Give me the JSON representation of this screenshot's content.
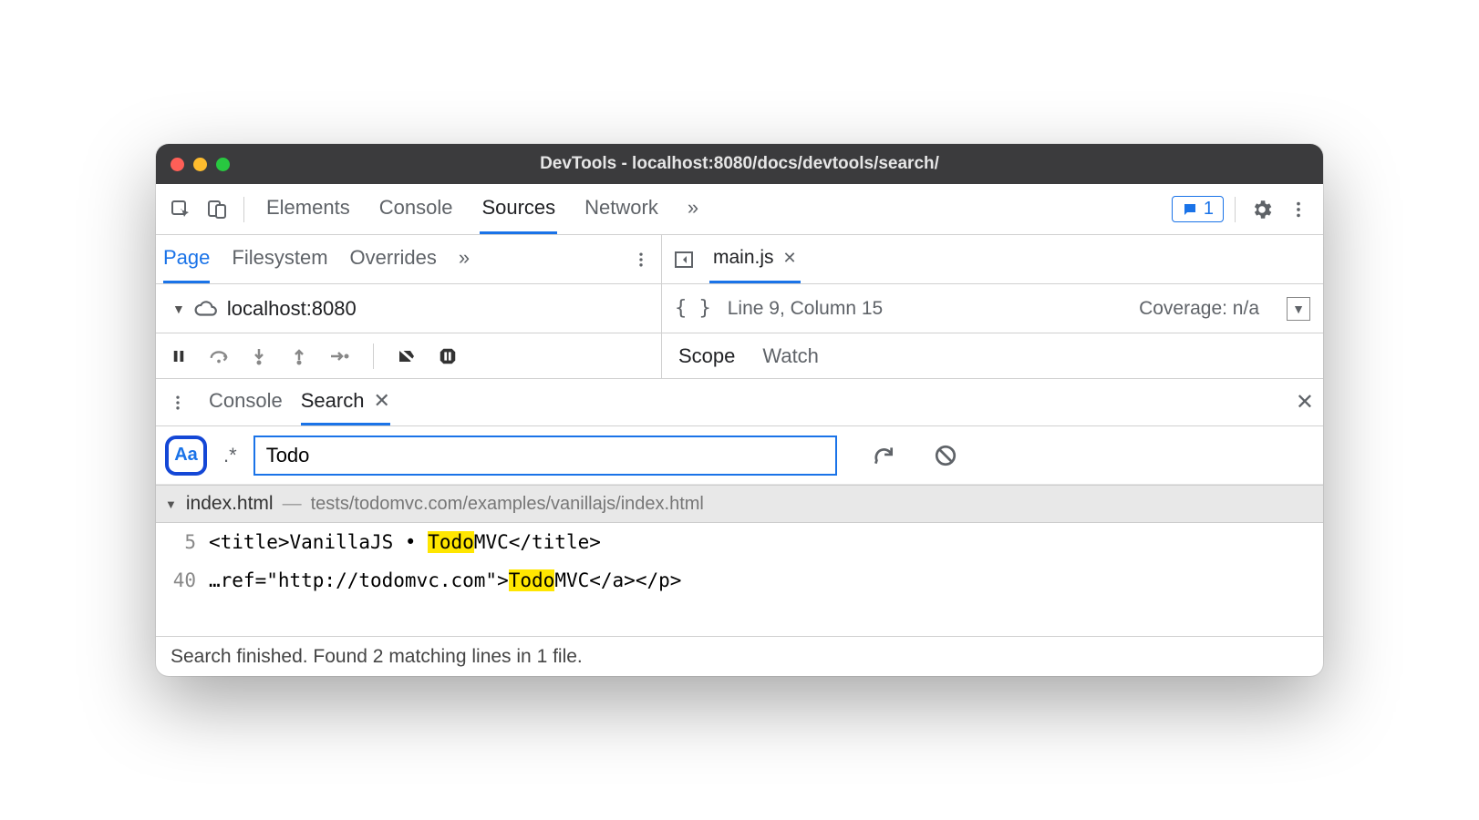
{
  "window": {
    "title": "DevTools - localhost:8080/docs/devtools/search/"
  },
  "mainTabs": {
    "elements": "Elements",
    "console": "Console",
    "sources": "Sources",
    "network": "Network"
  },
  "issues": {
    "count": "1"
  },
  "navTabs": {
    "page": "Page",
    "filesystem": "Filesystem",
    "overrides": "Overrides"
  },
  "editor": {
    "filename": "main.js",
    "cursor": "Line 9, Column 15",
    "coverage": "Coverage: n/a"
  },
  "tree": {
    "host": "localhost:8080"
  },
  "sidebar": {
    "scope": "Scope",
    "watch": "Watch"
  },
  "drawer": {
    "console": "Console",
    "search": "Search"
  },
  "search": {
    "caseLabel": "Aa",
    "regexLabel": ".*",
    "query": "Todo"
  },
  "results": {
    "file": {
      "name": "index.html",
      "path": "tests/todomvc.com/examples/vanillajs/index.html"
    },
    "lines": [
      {
        "num": "5",
        "pre": "<title>VanillaJS • ",
        "match": "Todo",
        "post": "MVC</title>"
      },
      {
        "num": "40",
        "pre": "…ref=\"http://todomvc.com\">",
        "match": "Todo",
        "post": "MVC</a></p>"
      }
    ]
  },
  "status": "Search finished.  Found 2 matching lines in 1 file."
}
